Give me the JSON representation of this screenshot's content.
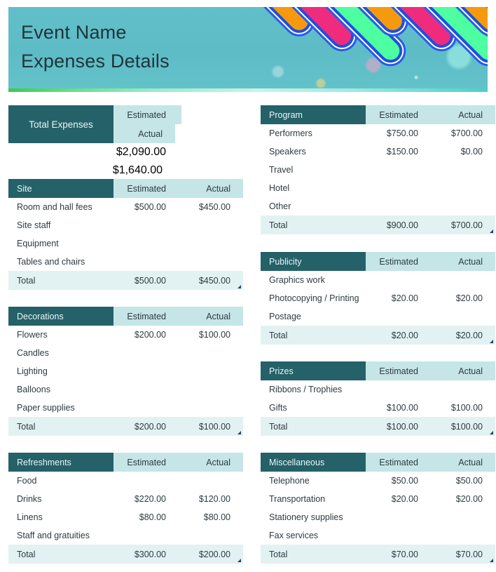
{
  "banner": {
    "title": "Event Name\nExpenses Details",
    "stripe_colors": [
      "#f59a0e",
      "#ef2b7d",
      "#4dffa0",
      "#f59a0e",
      "#ef2b7d",
      "#4dffa0",
      "#f59a0e",
      "#ef2b7d"
    ],
    "accent_dark_teal": "#256169",
    "accent_light_cyan": "#c5e5e6",
    "accent_total_row": "#e2f2f2",
    "banner_bg": "#5dbcc6"
  },
  "columns": {
    "estimated": "Estimated",
    "actual": "Actual"
  },
  "summary": {
    "label": "Total Expenses",
    "estimated": "$2,090.00",
    "actual": "$1,640.00"
  },
  "total_label": "Total",
  "tables": {
    "site": {
      "title": "Site",
      "rows": [
        {
          "name": "Room and hall fees",
          "estimated": "$500.00",
          "actual": "$450.00"
        },
        {
          "name": "Site staff",
          "estimated": "",
          "actual": ""
        },
        {
          "name": "Equipment",
          "estimated": "",
          "actual": ""
        },
        {
          "name": "Tables and chairs",
          "estimated": "",
          "actual": ""
        }
      ],
      "total": {
        "name": "Total",
        "estimated": "$500.00",
        "actual": "$450.00"
      }
    },
    "decorations": {
      "title": "Decorations",
      "rows": [
        {
          "name": "Flowers",
          "estimated": "$200.00",
          "actual": "$100.00"
        },
        {
          "name": "Candles",
          "estimated": "",
          "actual": ""
        },
        {
          "name": "Lighting",
          "estimated": "",
          "actual": ""
        },
        {
          "name": "Balloons",
          "estimated": "",
          "actual": ""
        },
        {
          "name": "Paper supplies",
          "estimated": "",
          "actual": ""
        }
      ],
      "total": {
        "name": "Total",
        "estimated": "$200.00",
        "actual": "$100.00"
      }
    },
    "refreshments": {
      "title": "Refreshments",
      "rows": [
        {
          "name": "Food",
          "estimated": "",
          "actual": ""
        },
        {
          "name": "Drinks",
          "estimated": "$220.00",
          "actual": "$120.00"
        },
        {
          "name": "Linens",
          "estimated": "$80.00",
          "actual": "$80.00"
        },
        {
          "name": "Staff and gratuities",
          "estimated": "",
          "actual": ""
        }
      ],
      "total": {
        "name": "Total",
        "estimated": "$300.00",
        "actual": "$200.00"
      }
    },
    "program": {
      "title": "Program",
      "rows": [
        {
          "name": "Performers",
          "estimated": "$750.00",
          "actual": "$700.00"
        },
        {
          "name": "Speakers",
          "estimated": "$150.00",
          "actual": "$0.00"
        },
        {
          "name": "Travel",
          "estimated": "",
          "actual": ""
        },
        {
          "name": "Hotel",
          "estimated": "",
          "actual": ""
        },
        {
          "name": "Other",
          "estimated": "",
          "actual": ""
        }
      ],
      "total": {
        "name": "Total",
        "estimated": "$900.00",
        "actual": "$700.00"
      }
    },
    "publicity": {
      "title": "Publicity",
      "rows": [
        {
          "name": "Graphics work",
          "estimated": "",
          "actual": ""
        },
        {
          "name": "Photocopying / Printing",
          "estimated": "$20.00",
          "actual": "$20.00"
        },
        {
          "name": "Postage",
          "estimated": "",
          "actual": ""
        }
      ],
      "total": {
        "name": "Total",
        "estimated": "$20.00",
        "actual": "$20.00"
      }
    },
    "prizes": {
      "title": "Prizes",
      "rows": [
        {
          "name": "Ribbons / Trophies",
          "estimated": "",
          "actual": ""
        },
        {
          "name": "Gifts",
          "estimated": "$100.00",
          "actual": "$100.00"
        }
      ],
      "total": {
        "name": "Total",
        "estimated": "$100.00",
        "actual": "$100.00"
      }
    },
    "miscellaneous": {
      "title": "Miscellaneous",
      "rows": [
        {
          "name": "Telephone",
          "estimated": "$50.00",
          "actual": "$50.00"
        },
        {
          "name": "Transportation",
          "estimated": "$20.00",
          "actual": "$20.00"
        },
        {
          "name": "Stationery supplies",
          "estimated": "",
          "actual": ""
        },
        {
          "name": "Fax services",
          "estimated": "",
          "actual": ""
        }
      ],
      "total": {
        "name": "Total",
        "estimated": "$70.00",
        "actual": "$70.00"
      }
    }
  }
}
